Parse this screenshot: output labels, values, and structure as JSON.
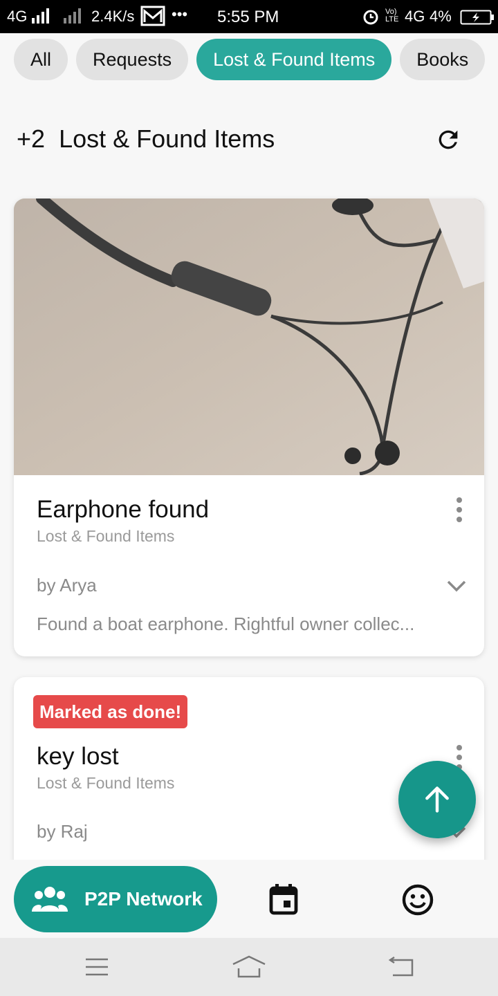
{
  "status_bar": {
    "network": "4G",
    "speed": "2.4K/s",
    "more": "•••",
    "time": "5:55 PM",
    "volte": "Vo) LTE",
    "network2": "4G",
    "battery": "4%"
  },
  "chips": [
    "All",
    "Requests",
    "Lost & Found Items",
    "Books"
  ],
  "header": {
    "count": "+2",
    "title": "Lost & Found Items"
  },
  "posts": [
    {
      "title": "Earphone found",
      "category": "Lost & Found Items",
      "author": "by Arya",
      "description": "Found a boat earphone. Rightful owner collec...",
      "has_image": true
    },
    {
      "badge": "Marked as done!",
      "title": "key lost",
      "category": "Lost & Found Items",
      "author": "by Raj"
    }
  ],
  "bottom_nav": {
    "active_label": "P2P Network",
    "items": [
      "people-icon",
      "calendar-icon",
      "smiley-icon"
    ]
  },
  "colors": {
    "accent": "#2aa89c",
    "badge": "#e64a4a"
  }
}
